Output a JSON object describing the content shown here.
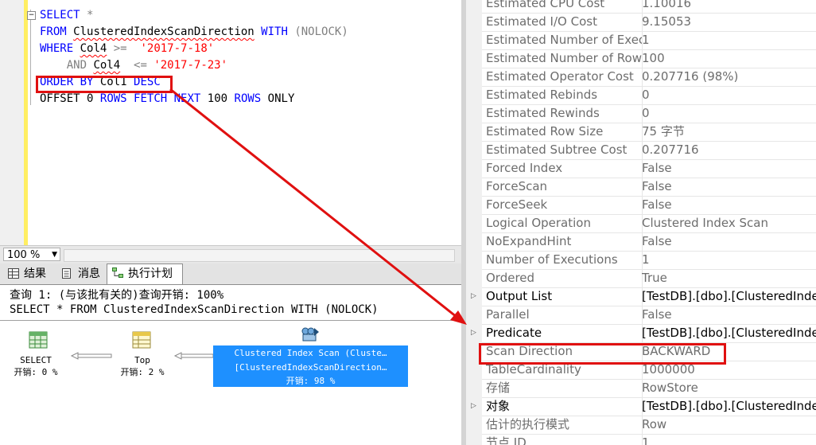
{
  "editor": {
    "lines": {
      "l1_kw": "SELECT",
      "l1_rest": " *",
      "l2_kw1": "FROM",
      "l2_table": "ClusteredIndexScanDirection",
      "l2_kw2": "WITH",
      "l2_hint": "(NOLOCK)",
      "l3_kw": "WHERE",
      "l3_col": "Col4",
      "l3_op": ">=",
      "l3_val": "'2017-7-18'",
      "l4_kw": "AND",
      "l4_col": "Col4",
      "l4_op": "<=",
      "l4_val": "'2017-7-23'",
      "l5_kw": "ORDER BY",
      "l5_col": "Col1",
      "l5_dir": "DESC",
      "l6_kw1": "OFFSET",
      "l6_n": "0",
      "l6_kw2": "ROWS FETCH",
      "l6_kw3": "NEXT",
      "l6_n2": "100",
      "l6_kw4": "ROWS",
      "l6_kw5": "ONLY"
    }
  },
  "zoom": {
    "value": "100 %"
  },
  "tabs": {
    "results": "结果",
    "messages": "消息",
    "plan": "执行计划"
  },
  "plan": {
    "header_line1": "查询 1: (与该批有关的)查询开销: 100%",
    "header_line2": "SELECT * FROM ClusteredIndexScanDirection WITH (NOLOCK)",
    "ops": {
      "select_name": "SELECT",
      "select_cost": "开销: 0 %",
      "top_name": "Top",
      "top_cost": "开销: 2 %",
      "scan_name": "Clustered Index Scan (Cluste…",
      "scan_obj": "[ClusteredIndexScanDirection…",
      "scan_cost": "开销: 98 %"
    }
  },
  "properties": [
    {
      "name": "Estimated CPU Cost",
      "value": "1.10016"
    },
    {
      "name": "Estimated I/O Cost",
      "value": "9.15053"
    },
    {
      "name": "Estimated Number of Exec",
      "value": "1"
    },
    {
      "name": "Estimated Number of Row",
      "value": "100"
    },
    {
      "name": "Estimated Operator Cost",
      "value": "0.207716 (98%)"
    },
    {
      "name": "Estimated Rebinds",
      "value": "0"
    },
    {
      "name": "Estimated Rewinds",
      "value": "0"
    },
    {
      "name": "Estimated Row Size",
      "value": "75 字节"
    },
    {
      "name": "Estimated Subtree Cost",
      "value": "0.207716"
    },
    {
      "name": "Forced Index",
      "value": "False"
    },
    {
      "name": "ForceScan",
      "value": "False"
    },
    {
      "name": "ForceSeek",
      "value": "False"
    },
    {
      "name": "Logical Operation",
      "value": "Clustered Index Scan"
    },
    {
      "name": "NoExpandHint",
      "value": "False"
    },
    {
      "name": "Number of Executions",
      "value": "1"
    },
    {
      "name": "Ordered",
      "value": "True"
    },
    {
      "name": "Output List",
      "value": "[TestDB].[dbo].[ClusteredInde"
    },
    {
      "name": "Parallel",
      "value": "False"
    },
    {
      "name": "Predicate",
      "value": "[TestDB].[dbo].[ClusteredInde"
    },
    {
      "name": "Scan Direction",
      "value": "BACKWARD"
    },
    {
      "name": "TableCardinality",
      "value": "1000000"
    },
    {
      "name": "存储",
      "value": "RowStore"
    },
    {
      "name": "对象",
      "value": "[TestDB].[dbo].[ClusteredInde"
    },
    {
      "name": "估计的执行模式",
      "value": "Row"
    },
    {
      "name": "节点 ID",
      "value": "1"
    }
  ],
  "colors": {
    "highlight": "#e01010",
    "selected_op": "#1e90ff",
    "keyword": "#0000ff",
    "string": "#ff0000"
  }
}
